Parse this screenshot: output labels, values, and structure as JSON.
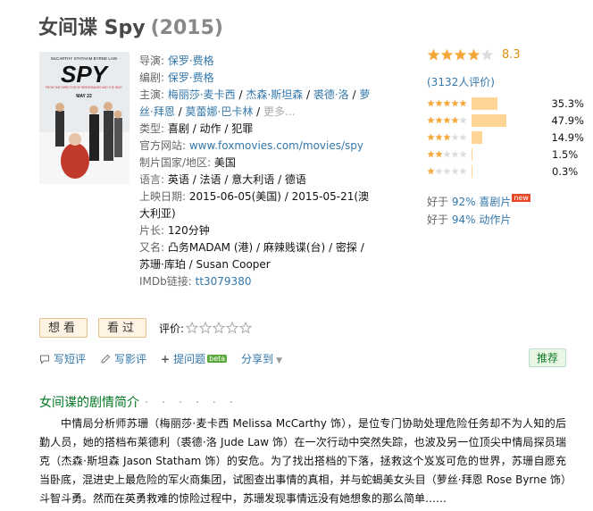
{
  "title": {
    "cn": "女间谍 Spy",
    "year": "(2015)"
  },
  "poster": {
    "cast_top": "McCARTHY  STATHAM  BYRNE  LAW",
    "logo": "SPY",
    "tagline": "FROM THE DIRECTOR OF BRIDESMAIDS AND THE HEAT",
    "date": "MAY 22"
  },
  "info": {
    "director_label": "导演: ",
    "director": "保罗·费格",
    "writer_label": "编剧: ",
    "writer": "保罗·费格",
    "cast_label": "主演: ",
    "cast": [
      "梅丽莎·麦卡西",
      "杰森·斯坦森",
      "裘德·洛",
      "萝丝·拜恩",
      "莫蕾娜·巴卡林"
    ],
    "cast_more": "更多...",
    "genre_label": "类型: ",
    "genres": [
      "喜剧",
      "动作",
      "犯罪"
    ],
    "site_label": "官方网站: ",
    "site": "www.foxmovies.com/movies/spy",
    "country_label": "制片国家/地区: ",
    "country": "美国",
    "language_label": "语言: ",
    "languages": [
      "英语",
      "法语",
      "意大利语",
      "德语"
    ],
    "release_label": "上映日期: ",
    "release_1": "2015-06-05(美国)",
    "release_2": "2015-05-21(澳大利亚)",
    "runtime_label": "片长: ",
    "runtime": "120分钟",
    "aka_label": "又名: ",
    "aka": [
      "凸务MADAM (港)",
      "麻辣贱谍(台)",
      "密探",
      "苏珊·库珀",
      "Susan Cooper"
    ],
    "imdb_label": "IMDb链接: ",
    "imdb": "tt3079380"
  },
  "rating": {
    "score": "8.3",
    "stars": 4.5,
    "count_text": "(3132人评价)",
    "breakdown": [
      {
        "stars": 5,
        "pct": "35.3%",
        "value": 35.3
      },
      {
        "stars": 4,
        "pct": "47.9%",
        "value": 47.9
      },
      {
        "stars": 3,
        "pct": "14.9%",
        "value": 14.9
      },
      {
        "stars": 2,
        "pct": "1.5%",
        "value": 1.5
      },
      {
        "stars": 1,
        "pct": "0.3%",
        "value": 0.3
      }
    ],
    "better_1_prefix": "好于 ",
    "better_1_link": "92% 喜剧片",
    "better_1_badge": "new",
    "better_2_prefix": "好于 ",
    "better_2_link": "94% 动作片"
  },
  "actions": {
    "want": "想看",
    "seen": "看过",
    "rate_label": "评价:"
  },
  "tools": {
    "write_short": "写短评",
    "write_review": "写影评",
    "ask": "提问题",
    "beta": "beta",
    "share": "分享到",
    "recommend": "推荐"
  },
  "synopsis": {
    "heading": "女间谍的剧情简介",
    "dots": "· · · · · ·",
    "text": "中情局分析师苏珊（梅丽莎·麦卡西 Melissa McCarthy 饰），是位专门协助处理危险任务却不为人知的后勤人员，她的搭档布莱德利（裘德·洛 Jude Law 饰）在一次行动中突然失踪，也波及另一位顶尖中情局探员瑞克（杰森·斯坦森 Jason Statham 饰）的安危。为了找出搭档的下落，拯救这个岌岌可危的世界，苏珊自愿充当卧底，混进史上最危险的军火商集团，试图查出事情的真相，并与蛇蝎美女头目（萝丝·拜恩 Rose Byrne 饰）斗智斗勇。然而在英勇救难的惊险过程中，苏珊发现事情远没有她想象的那么简单……"
  },
  "colors": {
    "link": "#3377aa",
    "star": "#f4a83a",
    "score": "#e09015",
    "bar": "#ffd596",
    "green": "#007722"
  }
}
